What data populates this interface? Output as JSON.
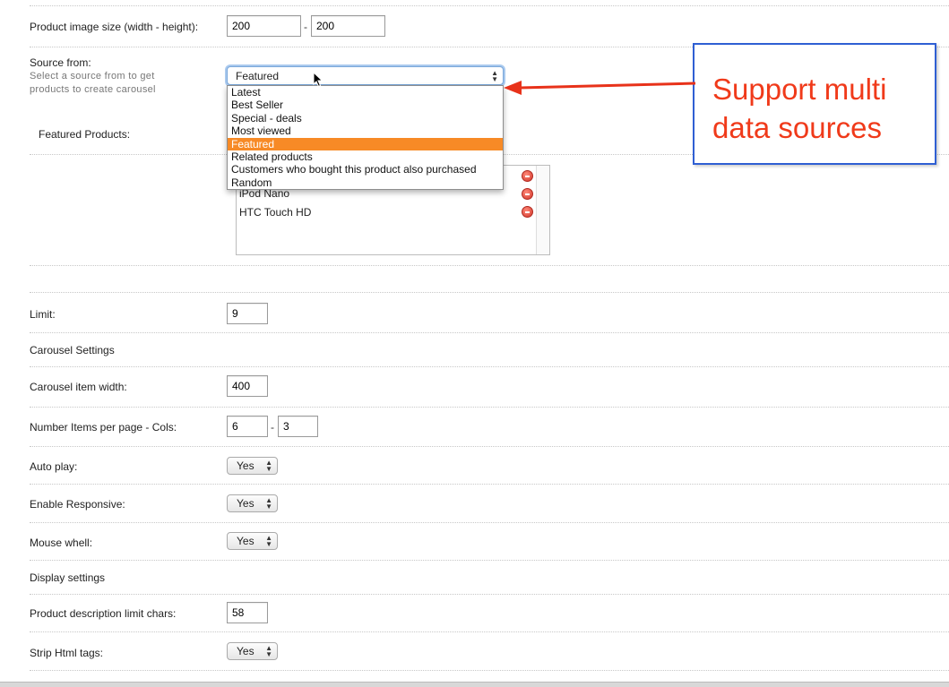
{
  "image_size": {
    "label": "Product image size (width - height):",
    "width": "200",
    "separator": "-",
    "height": "200"
  },
  "source": {
    "label": "Source from:",
    "hint_line1": "Select a source from to get",
    "hint_line2": "products to create carousel",
    "selected": "Featured",
    "options": [
      "Latest",
      "Best Seller",
      "Special - deals",
      "Most viewed",
      "Featured",
      "Related products",
      "Customers who bought this product also purchased",
      "Random"
    ],
    "selected_index": 4
  },
  "featured": {
    "label": "Featured Products:",
    "items": [
      "iPod Nano",
      "HTC Touch HD"
    ]
  },
  "limit": {
    "label": "Limit:",
    "value": "9"
  },
  "carousel_settings": {
    "heading": "Carousel Settings"
  },
  "item_width": {
    "label": "Carousel item width:",
    "value": "400"
  },
  "items_per_page": {
    "label": "Number Items per page - Cols:",
    "value1": "6",
    "separator": "-",
    "value2": "3"
  },
  "auto_play": {
    "label": "Auto play:",
    "value": "Yes"
  },
  "responsive": {
    "label": "Enable Responsive:",
    "value": "Yes"
  },
  "mouse_wheel": {
    "label": "Mouse whell:",
    "value": "Yes"
  },
  "display_settings": {
    "heading": "Display settings"
  },
  "desc_limit": {
    "label": "Product description limit chars:",
    "value": "58"
  },
  "strip_html": {
    "label": "Strip Html tags:",
    "value": "Yes"
  },
  "callout": {
    "line1": "Support multi",
    "line2": "data sources",
    "text_color": "#f03a1a",
    "border_color": "#2f5fd3"
  },
  "colors": {
    "selected_option": "#f78a26",
    "arrow": "#e8321a"
  }
}
